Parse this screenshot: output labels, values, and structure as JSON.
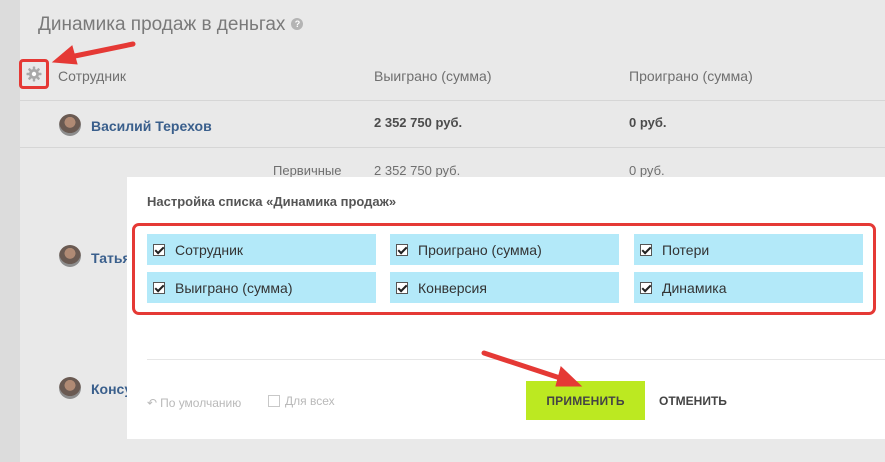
{
  "page": {
    "title": "Динамика продаж в деньгах",
    "help_icon": "?"
  },
  "table": {
    "headers": [
      "Сотрудник",
      "Выиграно (сумма)",
      "Проиграно (сумма)"
    ],
    "rows": [
      {
        "name": "Василий Терехов",
        "won": "2 352 750 руб.",
        "lost": "0 руб."
      },
      {
        "sublabel": "Первичные",
        "won": "2 352 750 руб.",
        "lost": "0 руб."
      },
      {
        "name": "Татья"
      },
      {
        "name": "Консу"
      }
    ]
  },
  "modal": {
    "title": "Настройка списка «Динамика продаж»",
    "options": [
      {
        "label": "Сотрудник",
        "checked": true
      },
      {
        "label": "Проиграно (сумма)",
        "checked": true
      },
      {
        "label": "Потери",
        "checked": true
      },
      {
        "label": "Выиграно (сумма)",
        "checked": true
      },
      {
        "label": "Конверсия",
        "checked": true
      },
      {
        "label": "Динамика",
        "checked": true
      }
    ],
    "default_link": "По умолчанию",
    "for_all_label": "Для всех",
    "for_all_checked": false,
    "apply_label": "ПРИМЕНИТЬ",
    "cancel_label": "ОТМЕНИТЬ"
  },
  "colors": {
    "annotation": "#e53935",
    "option_bg": "#b3e9f9",
    "apply_bg": "#bce921",
    "name_link": "#3a5f8c"
  },
  "icons": {
    "settings": "gear-icon",
    "help": "question-circle-icon",
    "default": "undo-icon"
  }
}
